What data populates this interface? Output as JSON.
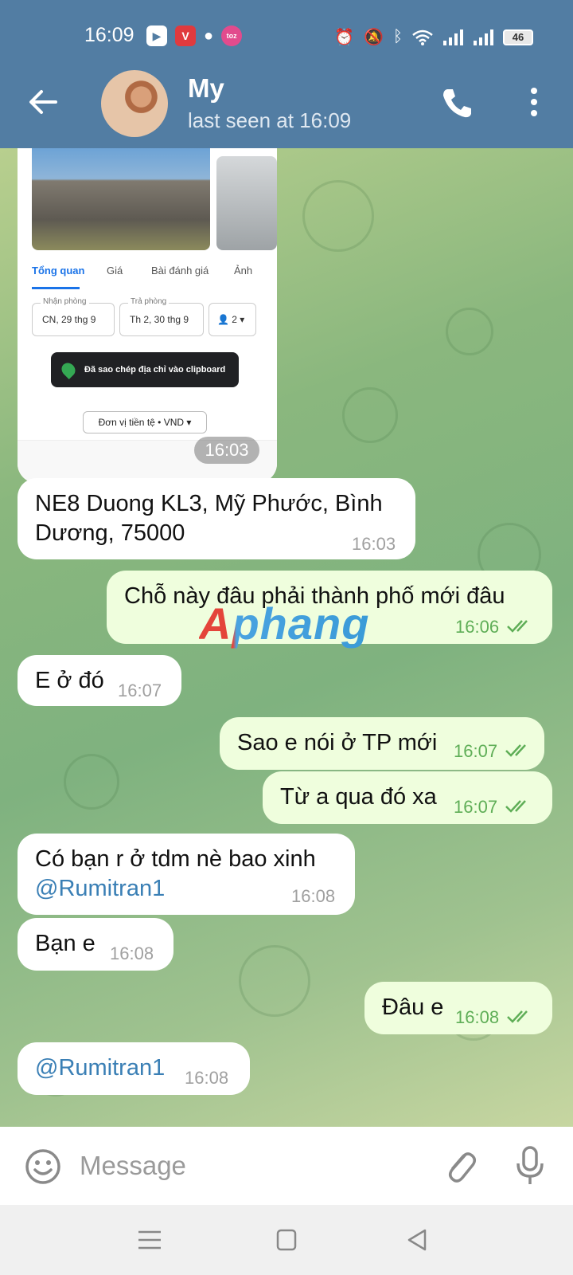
{
  "status_bar": {
    "time": "16:09",
    "battery": "46"
  },
  "header": {
    "name": "My",
    "status": "last seen at 16:09"
  },
  "image_message": {
    "tabs": [
      "Tổng quan",
      "Giá",
      "Bài đánh giá",
      "Ảnh"
    ],
    "checkin_label": "Nhận phòng",
    "checkin_value": "CN, 29 thg 9",
    "checkout_label": "Trả phòng",
    "checkout_value": "Th 2, 30 thg 9",
    "guests": "2",
    "toast": "Đã sao chép địa chỉ vào clipboard",
    "currency": "Đơn vị tiền tệ • VND",
    "time": "16:03"
  },
  "messages": [
    {
      "id": "m1",
      "text_line1": "NE8 Duong KL3, Mỹ Phước, Bình",
      "text_line2": "Dương, 75000",
      "time": "16:03"
    },
    {
      "id": "m2",
      "text": "Chỗ này đâu phải thành phố mới đâu",
      "time": "16:06"
    },
    {
      "id": "m3",
      "text": "E ở đó",
      "time": "16:07"
    },
    {
      "id": "m4",
      "text": "Sao e nói ở TP mới",
      "time": "16:07"
    },
    {
      "id": "m5",
      "text": "Từ a qua đó xa",
      "time": "16:07"
    },
    {
      "id": "m6",
      "text": "Có bạn r ở tdm nè bao xinh",
      "mention": "@Rumitran1",
      "time": "16:08"
    },
    {
      "id": "m7",
      "text": "Bạn e",
      "time": "16:08"
    },
    {
      "id": "m8",
      "text": "Đâu e",
      "time": "16:08"
    },
    {
      "id": "m9",
      "mention": "@Rumitran1",
      "time": "16:08"
    }
  ],
  "watermark": "Aphang",
  "input": {
    "placeholder": "Message"
  },
  "colors": {
    "header": "#527da3",
    "outgoing_bubble": "#effedd",
    "incoming_bubble": "#ffffff",
    "check": "#5fae57",
    "mention": "#3a7fb5"
  }
}
